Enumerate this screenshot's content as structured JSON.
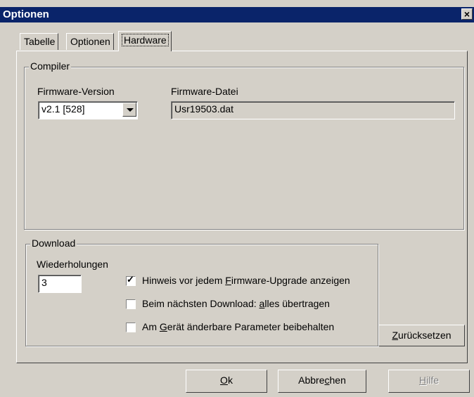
{
  "window": {
    "title": "Optionen",
    "close_glyph": "×"
  },
  "tabs": [
    {
      "label": "Tabelle"
    },
    {
      "label": "Optionen"
    },
    {
      "label": "Hardware",
      "active": true
    }
  ],
  "compiler": {
    "group_title": "Compiler",
    "firmware_version_label": "Firmware-Version",
    "firmware_version_value": "v2.1 [528]",
    "firmware_file_label": "Firmware-Datei",
    "firmware_file_value": "Usr19503.dat"
  },
  "download": {
    "group_title": "Download",
    "retries_label": "Wiederholungen",
    "retries_value": "3",
    "options": [
      {
        "pre": "Hinweis vor jedem ",
        "key": "F",
        "post": "irmware-Upgrade anzeigen",
        "checked": true
      },
      {
        "pre": "Beim nächsten Download: ",
        "key": "a",
        "post": "lles übertragen",
        "checked": false
      },
      {
        "pre": "Am ",
        "key": "G",
        "post": "erät änderbare Parameter beibehalten",
        "checked": false
      }
    ]
  },
  "buttons": {
    "reset": {
      "key": "Z",
      "rest": "urücksetzen"
    },
    "ok": {
      "key": "O",
      "rest": "k"
    },
    "cancel": {
      "pre": "Abbre",
      "key": "c",
      "post": "hen"
    },
    "help": {
      "key": "H",
      "rest": "ilfe",
      "disabled": true
    }
  },
  "colors": {
    "titlebar": "#0a246a",
    "face": "#d4d0c8"
  }
}
